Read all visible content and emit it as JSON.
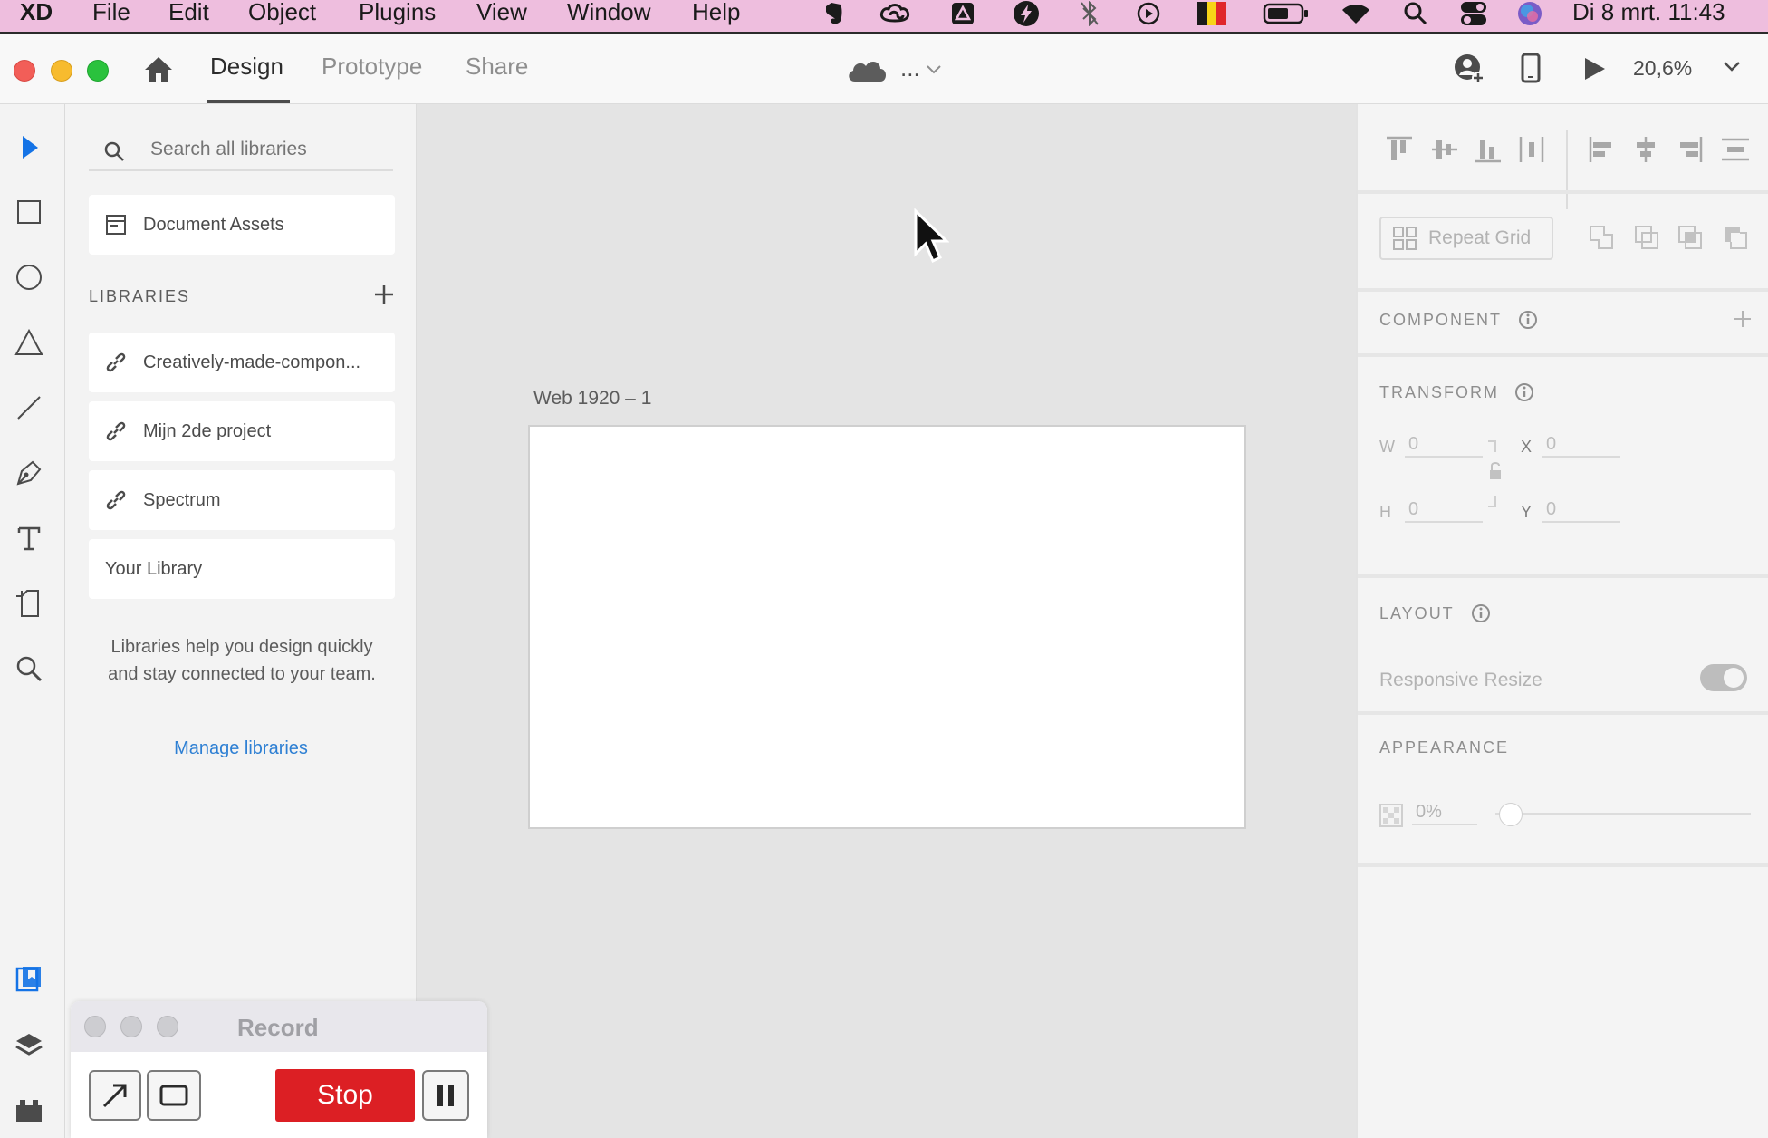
{
  "menubar": {
    "app": "XD",
    "items": [
      "File",
      "Edit",
      "Object",
      "Plugins",
      "View",
      "Window",
      "Help"
    ],
    "clock": "Di 8 mrt.  11:43",
    "flag_colors": [
      "#1a1a1a",
      "#f7d417",
      "#e0262b"
    ]
  },
  "titlebar": {
    "tabs": [
      "Design",
      "Prototype",
      "Share"
    ],
    "active_tab": "Design",
    "doc_status": "...",
    "zoom": "20,6%"
  },
  "library": {
    "search_placeholder": "Search all libraries",
    "document_assets": "Document Assets",
    "section_title": "LIBRARIES",
    "items": [
      "Creatively-made-compon...",
      "Mijn 2de project",
      "Spectrum"
    ],
    "your_library": "Your Library",
    "help_text": "Libraries help you design quickly and stay connected to your team.",
    "manage_link": "Manage libraries",
    "link_color": "#2d7fd3"
  },
  "canvas": {
    "artboard_label": "Web 1920 – 1"
  },
  "properties": {
    "repeat_grid": "Repeat Grid",
    "component_title": "COMPONENT",
    "transform_title": "TRANSFORM",
    "w_label": "W",
    "w_value": "0",
    "h_label": "H",
    "h_value": "0",
    "x_label": "X",
    "x_value": "0",
    "y_label": "Y",
    "y_value": "0",
    "layout_title": "LAYOUT",
    "responsive_resize": "Responsive Resize",
    "responsive_resize_on": true,
    "appearance_title": "APPEARANCE",
    "opacity": "0%"
  },
  "recorder": {
    "title": "Record",
    "stop_label": "Stop",
    "stop_color": "#dc1f24"
  },
  "accent_color": "#1473e6"
}
